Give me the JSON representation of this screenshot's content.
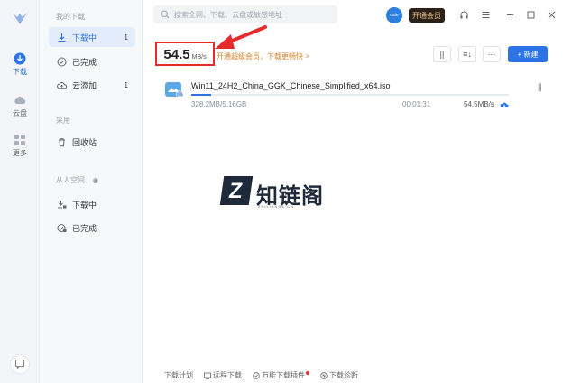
{
  "rail": {
    "items": [
      {
        "label": "下载",
        "icon": "download-icon",
        "active": true
      },
      {
        "label": "云盘",
        "icon": "cloud-icon",
        "active": false
      },
      {
        "label": "更多",
        "icon": "more-grid-icon",
        "active": false
      }
    ]
  },
  "sidebar": {
    "section_downloads": "我的下载",
    "items_downloads": [
      {
        "label": "下载中",
        "count": "1",
        "icon": "download-icon"
      },
      {
        "label": "已完成",
        "count": "",
        "icon": "check-circle-icon"
      },
      {
        "label": "云添加",
        "count": "1",
        "icon": "cloud-add-icon"
      }
    ],
    "section_fav": "采用",
    "items_fav": [
      {
        "label": "回收站",
        "icon": "trash-icon"
      }
    ],
    "section_remote": "从人空间",
    "items_remote": [
      {
        "label": "下载中",
        "icon": "download-lock-icon"
      },
      {
        "label": "已完成",
        "icon": "check-lock-icon"
      }
    ]
  },
  "topbar": {
    "search_placeholder": "搜索全网、下载、云盘或敏感地址",
    "vip_label": "开通会员",
    "avatar_text": "cute"
  },
  "speed": {
    "value": "54.5",
    "unit": "MB/s",
    "promo": "开通超级会员，下载更畅快 >"
  },
  "toolbar": {
    "pause_label": "||",
    "sort_label": "≡↓",
    "more_label": "···",
    "new_label": "+ 新建"
  },
  "task": {
    "name": "Win11_24H2_China_GGK_Chinese_Simplified_x64.iso",
    "size": "328.2MB/5.16GB",
    "remaining": "00:01:31",
    "rate": "54.5MB/s",
    "progress": 0.062,
    "pause_label": "||"
  },
  "watermark": {
    "brand": "知链阁",
    "letter": "Z",
    "sub": "ZHILIANGE.CN"
  },
  "bottom": [
    {
      "label": "下载计划",
      "icon": ""
    },
    {
      "label": "远程下载",
      "icon": "remote-icon"
    },
    {
      "label": "万能下载插件",
      "icon": "plugin-icon",
      "dot": true
    },
    {
      "label": "下载诊断",
      "icon": "diagnose-icon"
    }
  ],
  "colors": {
    "accent": "#2b73e6",
    "highlight_box": "#e52b2b",
    "promo": "#d9822b",
    "vip_bg": "#2b2118",
    "vip_text": "#f0c98b"
  }
}
